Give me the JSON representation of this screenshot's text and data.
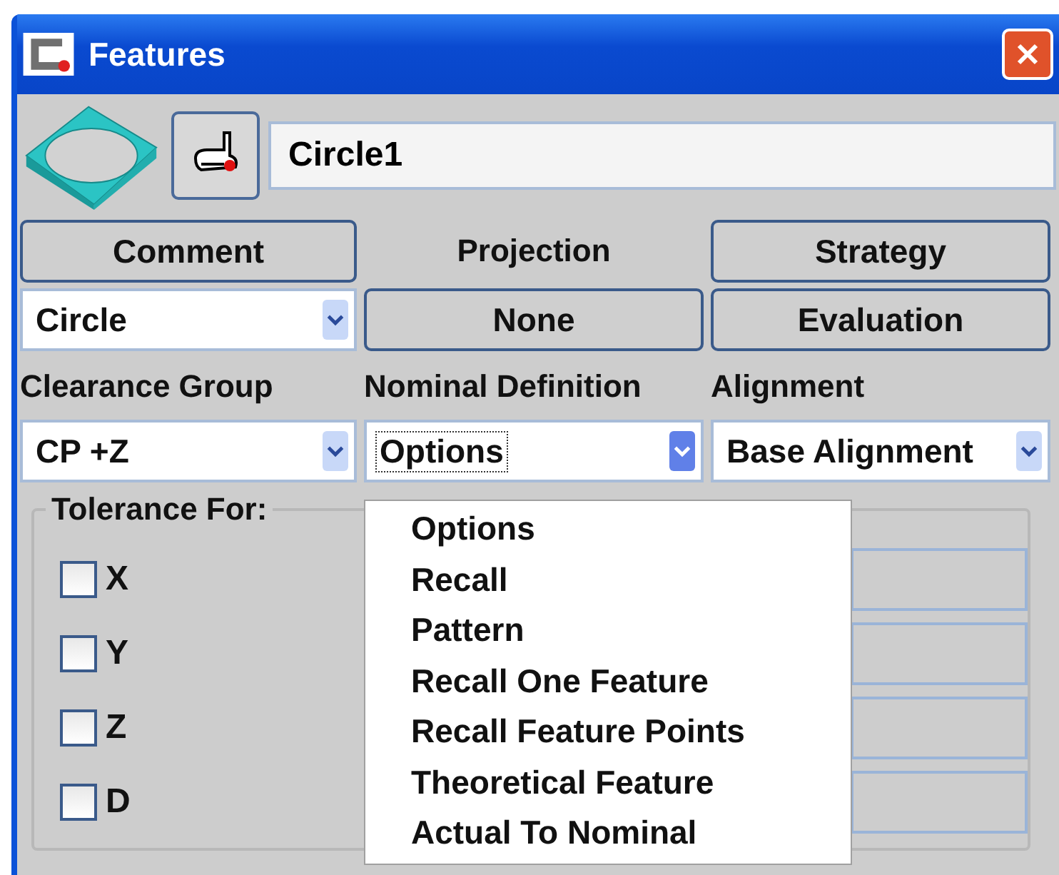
{
  "window": {
    "title": "Features"
  },
  "name_field": {
    "value": "Circle1"
  },
  "row1": {
    "comment_button": "Comment",
    "projection_label": "Projection",
    "strategy_button": "Strategy"
  },
  "row2": {
    "type_select": "Circle",
    "projection_button": "None",
    "evaluation_button": "Evaluation"
  },
  "labels": [
    "Clearance Group",
    "Nominal Definition",
    "Alignment"
  ],
  "selects": [
    {
      "value": "CP +Z",
      "focused": false
    },
    {
      "value": "Options",
      "focused": true
    },
    {
      "value": "Base Alignment",
      "focused": false
    }
  ],
  "tolerance": {
    "title": "Tolerance For:",
    "items": [
      {
        "label": "X",
        "checked": false
      },
      {
        "label": "Y",
        "checked": false
      },
      {
        "label": "Z",
        "checked": false
      },
      {
        "label": "D",
        "checked": false
      }
    ]
  },
  "dropdown": {
    "items": [
      "Options",
      "Recall",
      "Pattern",
      "Recall One Feature",
      "Recall Feature Points",
      "Theoretical Feature",
      "Actual To Nominal"
    ]
  }
}
